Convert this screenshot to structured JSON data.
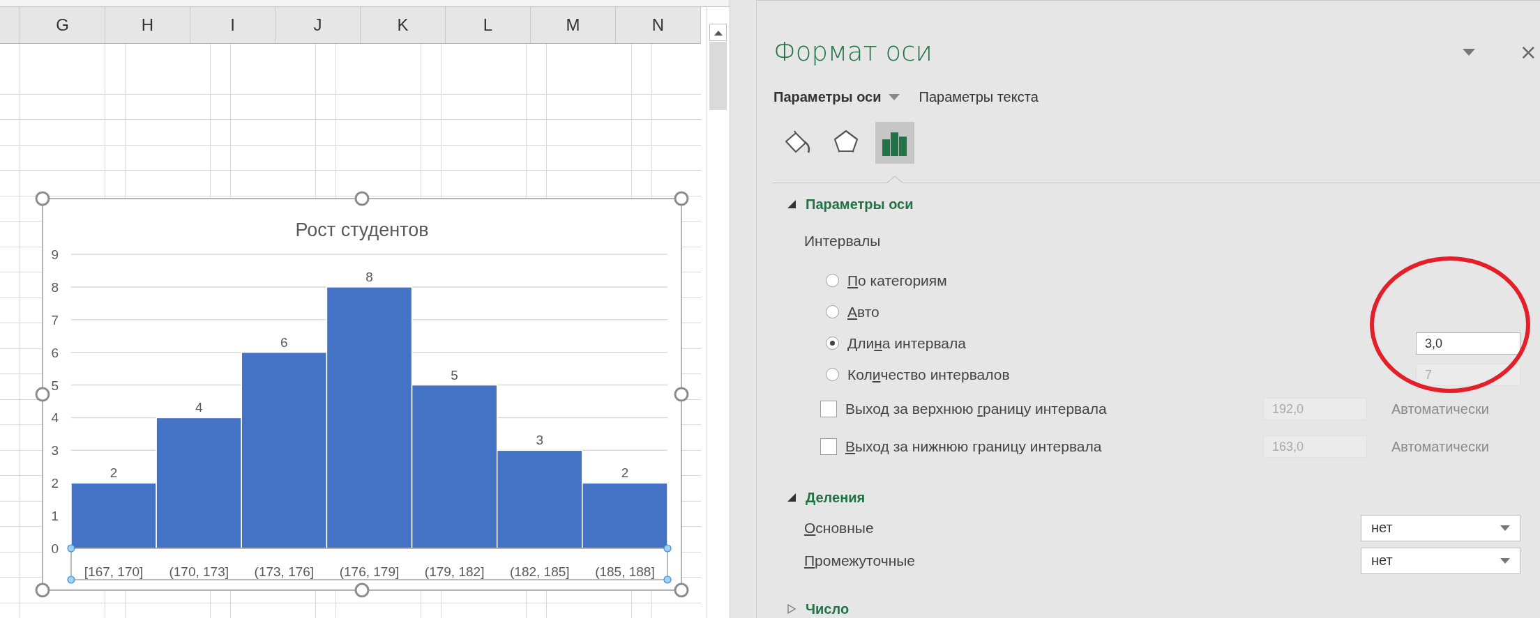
{
  "sheet": {
    "columns": [
      "G",
      "H",
      "I",
      "J",
      "K",
      "L",
      "M",
      "N"
    ]
  },
  "chart": {
    "selected": true,
    "axis_selected": true,
    "chart_data": {
      "type": "bar",
      "title": "Рост студентов",
      "categories": [
        "[167, 170]",
        "(170, 173]",
        "(173, 176]",
        "(176, 179]",
        "(179, 182]",
        "(182, 185]",
        "(185, 188]"
      ],
      "series": [
        {
          "color": "#4472c4",
          "values": [
            2,
            4,
            6,
            8,
            5,
            3,
            2
          ]
        }
      ],
      "ylim": [
        0,
        9
      ],
      "yticks": [
        0,
        1,
        2,
        3,
        4,
        5,
        6,
        7,
        8,
        9
      ],
      "grid": true,
      "data_labels": true
    }
  },
  "panel": {
    "title": "Формат оси",
    "close": "×",
    "tabs": [
      {
        "label": "Параметры оси",
        "selected": true,
        "has_menu": true
      },
      {
        "label": "Параметры текста",
        "selected": false,
        "has_menu": false
      }
    ],
    "icon_tabs": [
      {
        "kind": "fill",
        "selected": false
      },
      {
        "kind": "effects",
        "selected": false
      },
      {
        "kind": "axis",
        "selected": true
      }
    ],
    "sections": [
      {
        "title": "Параметры оси",
        "expanded": true,
        "items": [
          {
            "kind": "heading",
            "text": "Интервалы"
          },
          {
            "kind": "radio",
            "label": {
              "key": "П",
              "rest": "о категориям"
            },
            "selected": false
          },
          {
            "kind": "radio",
            "label": {
              "key": "А",
              "rest": "вто"
            },
            "selected": false
          },
          {
            "kind": "radio",
            "label": {
              "before": "Дли",
              "key": "н",
              "rest": "а интервала"
            },
            "selected": true,
            "field": {
              "value": "3,0",
              "disabled": false
            }
          },
          {
            "kind": "radio",
            "label": {
              "before": "Кол",
              "key": "и",
              "rest": "чество интервалов"
            },
            "selected": false,
            "field": {
              "value": "7",
              "disabled": true
            }
          },
          {
            "kind": "checkbox",
            "label": {
              "before": "Выход за верхнюю ",
              "key": "г",
              "rest": "раницу интервала"
            },
            "checked": false,
            "field": {
              "value": "192,0",
              "disabled": true
            },
            "note": "Автоматически"
          },
          {
            "kind": "checkbox",
            "label": {
              "key": "В",
              "rest": "ыход за нижнюю границу интервала"
            },
            "checked": false,
            "field": {
              "value": "163,0",
              "disabled": true
            },
            "note": "Автоматически"
          }
        ]
      },
      {
        "title": "Деления",
        "expanded": true,
        "items": [
          {
            "kind": "select",
            "label": {
              "key": "О",
              "rest": "сновные"
            },
            "value": "нет"
          },
          {
            "kind": "select",
            "label": {
              "key": "П",
              "rest": "ромежуточные"
            },
            "value": "нет"
          }
        ]
      },
      {
        "title": "Число",
        "expanded": false
      }
    ],
    "highlight": {
      "color": "#e3202a"
    }
  }
}
